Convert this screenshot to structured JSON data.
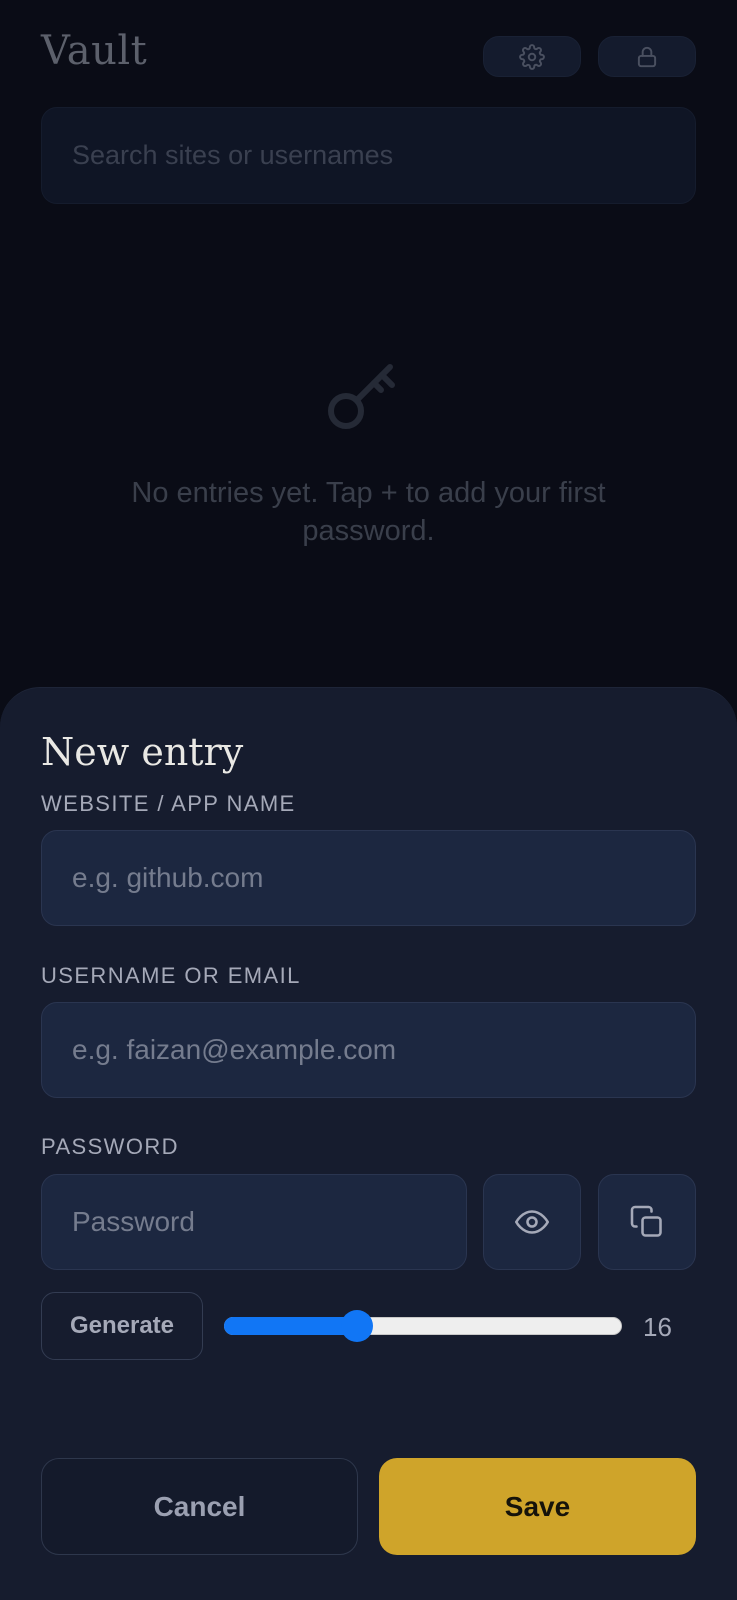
{
  "vault": {
    "title": "Vault",
    "search": {
      "placeholder": "Search sites or usernames"
    },
    "empty_state": {
      "message": "No entries yet. Tap + to add your first password."
    },
    "icons": {
      "settings": "gear-icon",
      "lock": "lock-icon",
      "empty": "key-icon"
    }
  },
  "sheet": {
    "title": "New entry",
    "website": {
      "label": "WEBSITE / APP NAME",
      "placeholder": "e.g. github.com",
      "value": ""
    },
    "username": {
      "label": "USERNAME OR EMAIL",
      "placeholder": "e.g. faizan@example.com",
      "value": ""
    },
    "password": {
      "label": "PASSWORD",
      "placeholder": "Password",
      "value": ""
    },
    "icons": {
      "reveal": "eye-icon",
      "copy": "copy-icon"
    },
    "generate_label": "Generate",
    "length": {
      "value": "16",
      "min": 8,
      "max": 32
    },
    "cancel_label": "Cancel",
    "save_label": "Save"
  },
  "colors": {
    "background": "#0a0c16",
    "sheet": "#161c2e",
    "field": "#1c2740",
    "accent": "#cfa42a",
    "slider": "#1176f5"
  }
}
